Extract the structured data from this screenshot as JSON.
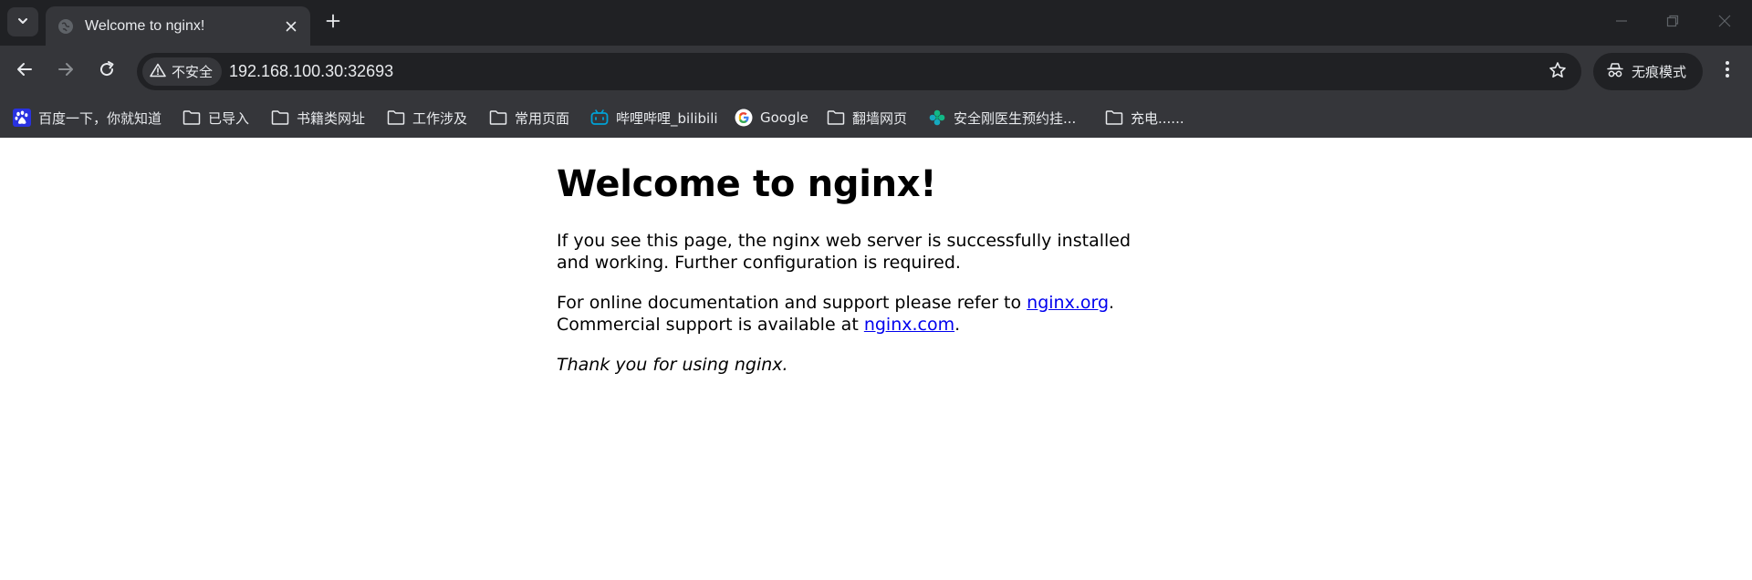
{
  "tab": {
    "title": "Welcome to nginx!"
  },
  "toolbar": {
    "security_label": "不安全",
    "url": "192.168.100.30:32693",
    "incognito_label": "无痕模式"
  },
  "bookmarks": [
    {
      "label": "百度一下，你就知道",
      "icon": "baidu-icon"
    },
    {
      "label": "已导入",
      "icon": "folder-icon"
    },
    {
      "label": "书籍类网址",
      "icon": "folder-icon"
    },
    {
      "label": "工作涉及",
      "icon": "folder-icon"
    },
    {
      "label": "常用页面",
      "icon": "folder-icon"
    },
    {
      "label": "哔哩哔哩_bilibili",
      "icon": "bilibili-icon"
    },
    {
      "label": "Google",
      "icon": "google-icon"
    },
    {
      "label": "翻墙网页",
      "icon": "folder-icon"
    },
    {
      "label": "安全刚医生预约挂...",
      "icon": "clover-icon"
    },
    {
      "label": "充电......",
      "icon": "folder-icon"
    }
  ],
  "page": {
    "heading": "Welcome to nginx!",
    "p1": "If you see this page, the nginx web server is successfully installed and working. Further configuration is required.",
    "p2_prefix": "For online documentation and support please refer to ",
    "link1": "nginx.org",
    "p2_mid": ".",
    "p2_line2": "Commercial support is available at ",
    "link2": "nginx.com",
    "p2_suffix": ".",
    "p3": "Thank you for using nginx."
  },
  "colors": {
    "tabstrip_bg": "#202124",
    "toolbar_bg": "#35363a",
    "text_light": "#e8eaed",
    "link": "#0000ee"
  }
}
